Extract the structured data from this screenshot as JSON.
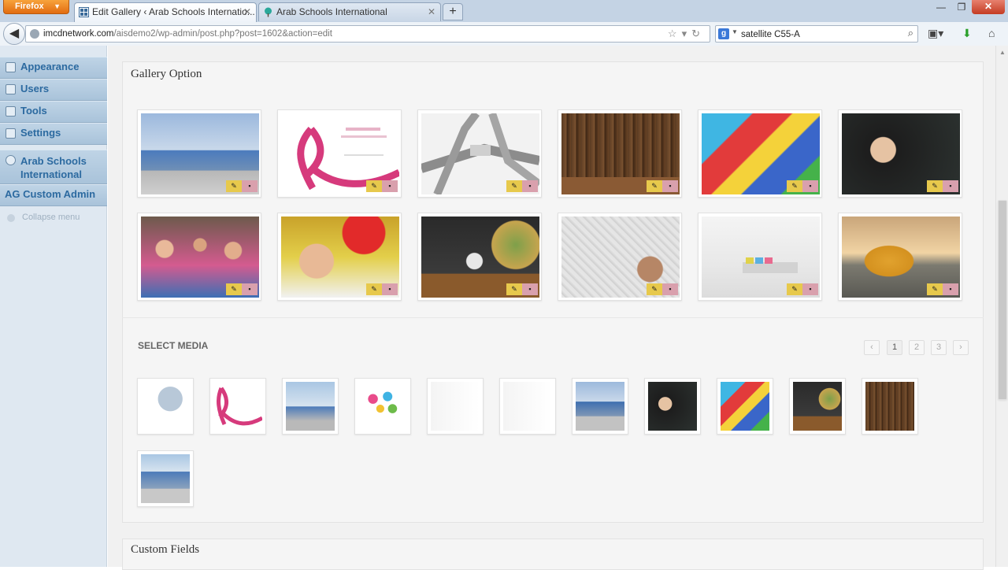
{
  "browser": {
    "menu_label": "Firefox",
    "tabs": [
      {
        "label": "Edit Gallery ‹ Arab Schools Internatio...",
        "active": true
      },
      {
        "label": "Arab Schools International",
        "active": false
      }
    ],
    "url_host": "imcdnetwork.com",
    "url_path": "/aisdemo2/wp-admin/post.php?post=1602&action=edit",
    "search_value": "satellite C55-A"
  },
  "sidebar": {
    "items": [
      {
        "label": "Appearance",
        "icon": "appearance-icon"
      },
      {
        "label": "Users",
        "icon": "users-icon"
      },
      {
        "label": "Tools",
        "icon": "tools-icon"
      },
      {
        "label": "Settings",
        "icon": "settings-icon"
      },
      {
        "label": "Arab Schools International",
        "icon": "gear-icon"
      },
      {
        "label": "AG Custom Admin",
        "icon": ""
      }
    ],
    "collapse_label": "Collapse menu"
  },
  "gallery": {
    "title": "Gallery Option",
    "select_media_label": "SELECT MEDIA",
    "pages": [
      "1",
      "2",
      "3"
    ],
    "current_page": "1"
  },
  "custom_fields": {
    "title": "Custom Fields"
  },
  "colors": {
    "accent": "#2c6aa0",
    "edit": "#e7c94c",
    "delete": "#d9a0ad"
  }
}
